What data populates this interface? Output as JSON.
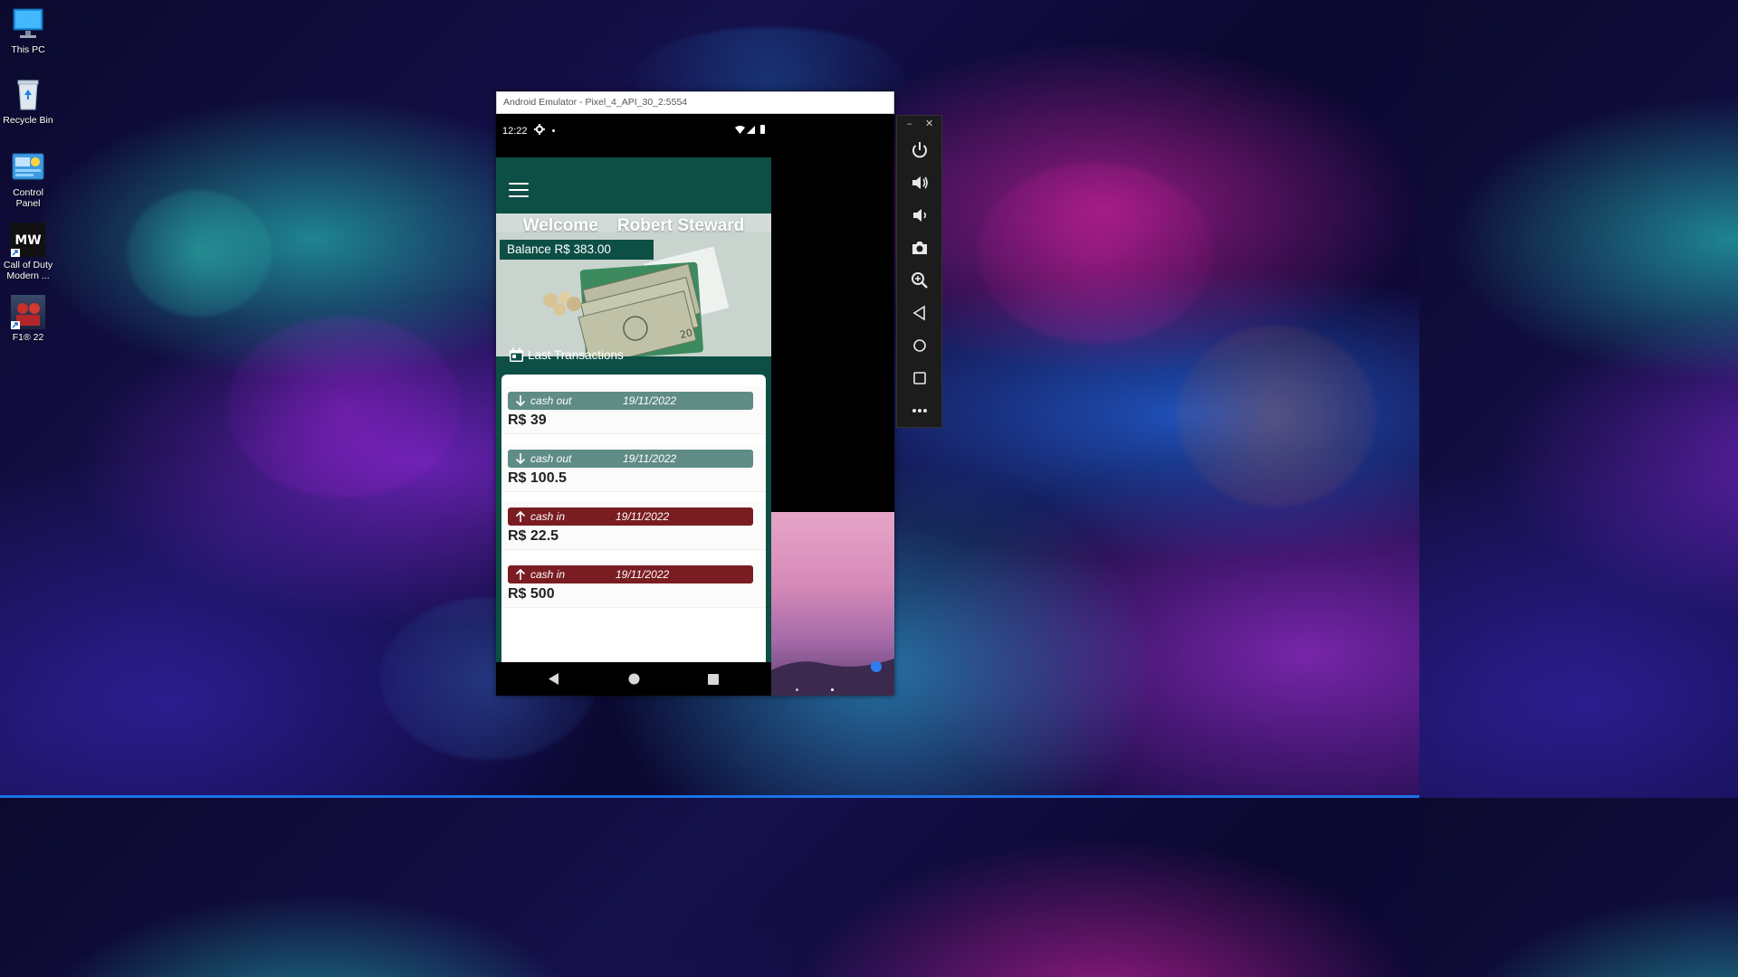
{
  "desktop": {
    "icons": [
      {
        "label": "This PC"
      },
      {
        "label": "Recycle Bin"
      },
      {
        "label": "Control Panel"
      },
      {
        "label": "Call of Duty Modern ..."
      },
      {
        "label": "F1® 22"
      }
    ]
  },
  "emulator": {
    "title": "Android Emulator - Pixel_4_API_30_2:5554",
    "status": {
      "time": "12:22"
    },
    "app": {
      "welcome": "Welcome    Robert Steward",
      "balance": "Balance R$ 383.00",
      "section_title": "Last Transactions",
      "transactions": [
        {
          "type": "cash out",
          "date": "19/11/2022",
          "amount": "R$ 39",
          "color": "#5f8c85"
        },
        {
          "type": "cash out",
          "date": "19/11/2022",
          "amount": "R$ 100.5",
          "color": "#5f8c85"
        },
        {
          "type": "cash in",
          "date": "19/11/2022",
          "amount": "R$ 22.5",
          "color": "#7a1d22"
        },
        {
          "type": "cash in",
          "date": "19/11/2022",
          "amount": "R$ 500",
          "color": "#7a1d22"
        }
      ]
    },
    "toolbar": {
      "minimize": "–",
      "close": "✕",
      "buttons": [
        "power-icon",
        "volume-up-icon",
        "volume-down-icon",
        "camera-icon",
        "zoom-icon",
        "back-icon",
        "home-icon",
        "overview-icon",
        "more-icon"
      ]
    }
  },
  "colors": {
    "app_primary": "#0d4e45",
    "cash_out": "#5f8c85",
    "cash_in": "#7a1d22"
  }
}
